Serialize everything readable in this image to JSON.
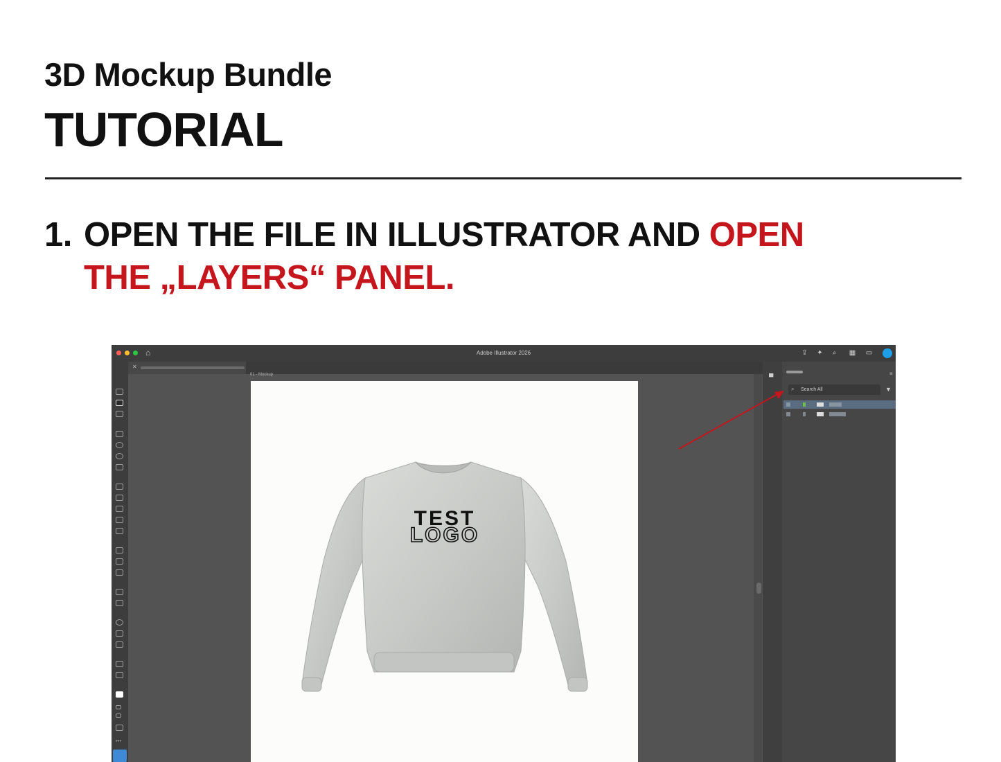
{
  "header": {
    "subtitle": "3D Mockup Bundle",
    "title": "TUTORIAL"
  },
  "step": {
    "number": "1.",
    "text_black": "OPEN THE FILE IN ILLUSTRATOR AND",
    "text_red_1": "OPEN",
    "text_red_2": "THE „LAYERS“ PANEL."
  },
  "app": {
    "title": "Adobe Illustrator 2026",
    "artboard_label": "01 - Mockup",
    "layers_panel": {
      "search_placeholder": "Search All"
    },
    "artwork": {
      "logo_line1": "TEST",
      "logo_line2": "LOGO"
    }
  },
  "colors": {
    "accent_red": "#c4161c",
    "text": "#111111",
    "app_bg": "#535353",
    "panel_bg": "#464646"
  }
}
